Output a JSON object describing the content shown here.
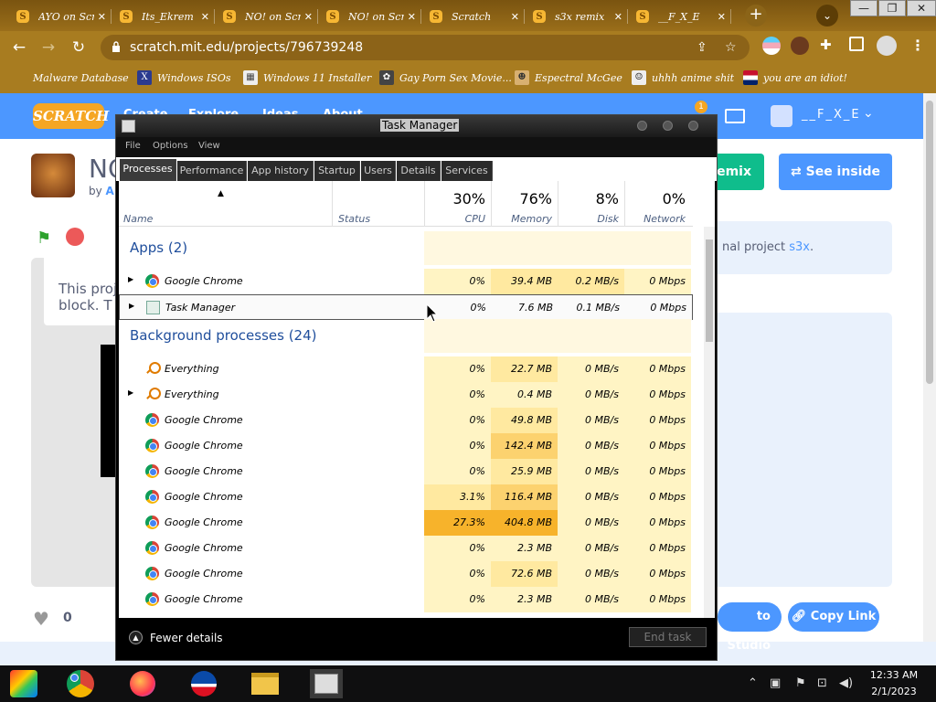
{
  "browser": {
    "tabs": [
      {
        "title": "AYO on Scratch"
      },
      {
        "title": "Its_Ekrem"
      },
      {
        "title": "NO! on Scratch"
      },
      {
        "title": "NO! on Scratch"
      },
      {
        "title": "Scratch"
      },
      {
        "title": "s3x remix"
      },
      {
        "title": "__F_X_E"
      }
    ],
    "new_tab_label": "+",
    "window_controls": {
      "minimize": "—",
      "restore": "❐",
      "close": "✕"
    },
    "url": "scratch.mit.edu/projects/796739248",
    "bookmarks": [
      {
        "label": "Malware Database"
      },
      {
        "label": "Windows ISOs"
      },
      {
        "label": "Windows 11 Installer"
      },
      {
        "label": "Gay Porn Sex Movie..."
      },
      {
        "label": "Espectral McGee"
      },
      {
        "label": "uhhh anime shit"
      },
      {
        "label": "you are an idiot!"
      }
    ]
  },
  "scratch": {
    "nav": {
      "logo": "SCRATCH",
      "items": [
        "Create",
        "Explore",
        "Ideas",
        "About"
      ],
      "notification_count": "1",
      "username": "__F_X_E"
    },
    "project_title": "NO",
    "by_prefix": "by",
    "author": "A",
    "stage_notice": "This proj\nblock. T",
    "remix_label": "Remix",
    "see_inside_label": "See inside",
    "notes_text": "nal project",
    "notes_link": "s3x",
    "notes_suffix": ".",
    "love_count": "0",
    "add_to_studio_label": "to Studio",
    "copy_link_label": "Copy Link"
  },
  "task_manager": {
    "title": "Task Manager",
    "menu": [
      "File",
      "Options",
      "View"
    ],
    "tabs": [
      "Processes",
      "Performance",
      "App history",
      "Startup",
      "Users",
      "Details",
      "Services"
    ],
    "active_tab": "Processes",
    "header": {
      "name": "Name",
      "status": "Status",
      "cpu": {
        "pct": "30%",
        "label": "CPU"
      },
      "memory": {
        "pct": "76%",
        "label": "Memory"
      },
      "disk": {
        "pct": "8%",
        "label": "Disk"
      },
      "network": {
        "pct": "0%",
        "label": "Network"
      }
    },
    "apps_group": "Apps (2)",
    "apps": [
      {
        "name": "Google Chrome",
        "cpu": "0%",
        "memory": "39.4 MB",
        "disk": "0.2 MB/s",
        "network": "0 Mbps"
      },
      {
        "name": "Task Manager",
        "cpu": "0%",
        "memory": "7.6 MB",
        "disk": "0.1 MB/s",
        "network": "0 Mbps"
      }
    ],
    "bg_group": "Background processes (24)",
    "background": [
      {
        "name": "Everything",
        "cpu": "0%",
        "memory": "22.7 MB",
        "disk": "0 MB/s",
        "network": "0 Mbps"
      },
      {
        "name": "Everything",
        "cpu": "0%",
        "memory": "0.4 MB",
        "disk": "0 MB/s",
        "network": "0 Mbps"
      },
      {
        "name": "Google Chrome",
        "cpu": "0%",
        "memory": "49.8 MB",
        "disk": "0 MB/s",
        "network": "0 Mbps"
      },
      {
        "name": "Google Chrome",
        "cpu": "0%",
        "memory": "142.4 MB",
        "disk": "0 MB/s",
        "network": "0 Mbps"
      },
      {
        "name": "Google Chrome",
        "cpu": "0%",
        "memory": "25.9 MB",
        "disk": "0 MB/s",
        "network": "0 Mbps"
      },
      {
        "name": "Google Chrome",
        "cpu": "3.1%",
        "memory": "116.4 MB",
        "disk": "0 MB/s",
        "network": "0 Mbps"
      },
      {
        "name": "Google Chrome",
        "cpu": "27.3%",
        "memory": "404.8 MB",
        "disk": "0 MB/s",
        "network": "0 Mbps"
      },
      {
        "name": "Google Chrome",
        "cpu": "0%",
        "memory": "2.3 MB",
        "disk": "0 MB/s",
        "network": "0 Mbps"
      },
      {
        "name": "Google Chrome",
        "cpu": "0%",
        "memory": "72.6 MB",
        "disk": "0 MB/s",
        "network": "0 Mbps"
      },
      {
        "name": "Google Chrome",
        "cpu": "0%",
        "memory": "2.3 MB",
        "disk": "0 MB/s",
        "network": "0 Mbps"
      }
    ],
    "fewer_details": "Fewer details",
    "end_task": "End task",
    "colors": {
      "heat_low": "#fff4c4",
      "heat_mid": "#ffe9a0",
      "heat_high": "#fcd26f",
      "heat_max": "#f7b32b"
    }
  },
  "taskbar": {
    "apps": [
      "start-icon",
      "chrome-icon",
      "firefox-icon",
      "obama-icon",
      "file-explorer-icon",
      "task-manager-icon"
    ],
    "time": "12:33 AM",
    "date": "2/1/2023"
  }
}
